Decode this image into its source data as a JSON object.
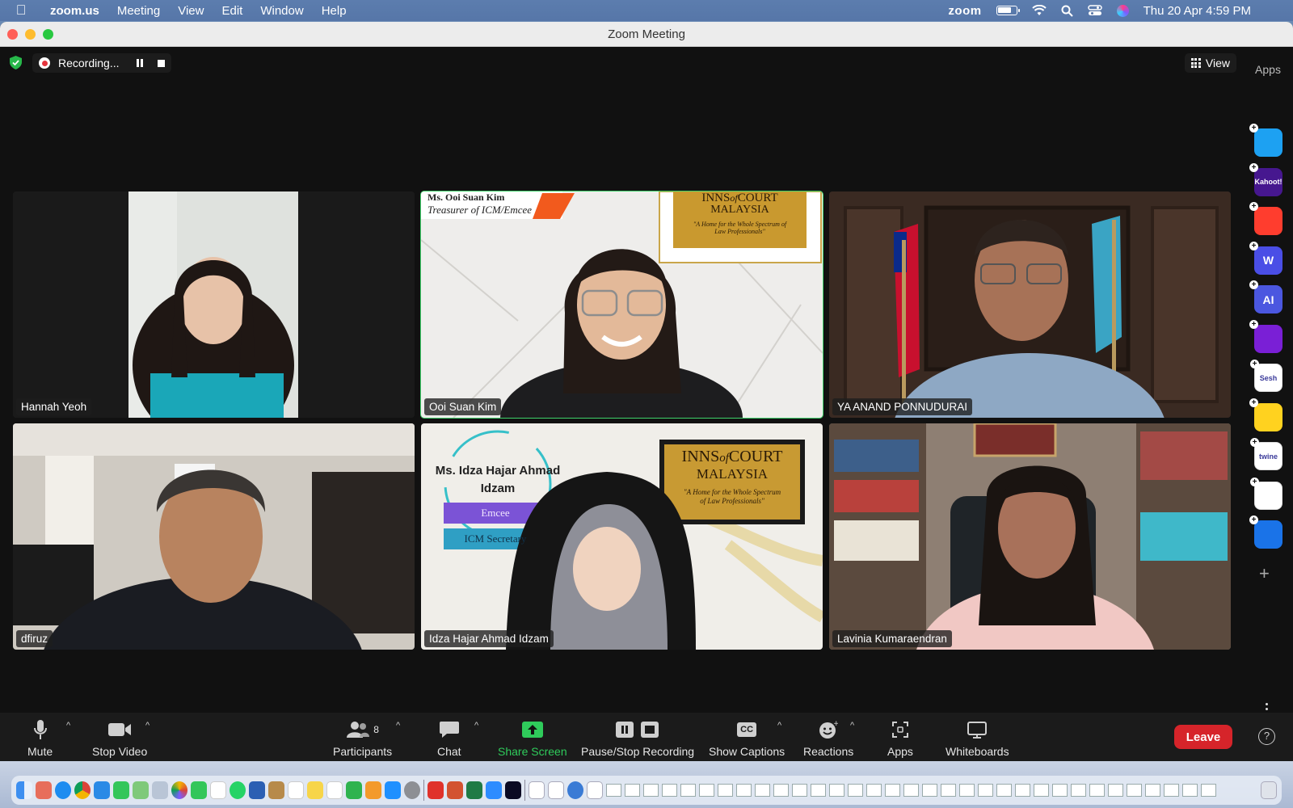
{
  "menubar": {
    "app": "zoom.us",
    "menus": [
      "Meeting",
      "View",
      "Edit",
      "Window",
      "Help"
    ],
    "status_app": "zoom",
    "datetime": "Thu 20 Apr  4:59 PM"
  },
  "window": {
    "title": "Zoom Meeting"
  },
  "recording": {
    "label": "Recording..."
  },
  "view_button": {
    "label": "View"
  },
  "participants": [
    {
      "name": "Hannah Yeoh",
      "active": false
    },
    {
      "name": "Ooi Suan Kim",
      "active": true
    },
    {
      "name": "YA ANAND PONNUDURAI",
      "active": false
    },
    {
      "name": "dfiruz",
      "active": false
    },
    {
      "name": "Idza Hajar Ahmad Idzam",
      "active": false
    },
    {
      "name": "Lavinia Kumaraendran",
      "active": false
    }
  ],
  "backgrounds": {
    "ooi_banner_name": "Ms. Ooi Suan Kim",
    "ooi_banner_role": "Treasurer of ICM/Emcee",
    "inns_title_1": "INNS",
    "inns_title_of": "of",
    "inns_title_2": "COURT",
    "inns_sub": "MALAYSIA",
    "inns_tagline": "\"A Home for the Whole Spectrum of Law Professionals\"",
    "idza_name_1": "Ms. Idza Hajar Ahmad",
    "idza_name_2": "Idzam",
    "idza_role_1": "Emcee",
    "idza_role_2": "ICM Secretary"
  },
  "apps_panel": {
    "title": "Apps",
    "apps": [
      {
        "name": "play-app-icon",
        "label": "",
        "color": "#1da1f2"
      },
      {
        "name": "kahoot-icon",
        "label": "Kahoot!",
        "color": "#46178f"
      },
      {
        "name": "orange-app-icon",
        "label": "",
        "color": "#ff3d2e"
      },
      {
        "name": "wordwall-icon",
        "label": "W",
        "color": "#4a4ee6"
      },
      {
        "name": "ai-app-icon",
        "label": "AI",
        "color": "#4b57e0"
      },
      {
        "name": "video-app-icon",
        "label": "",
        "color": "#7a1fd6"
      },
      {
        "name": "sesh-icon",
        "label": "Sesh",
        "color": "#ffffff"
      },
      {
        "name": "emoji-app-icon",
        "label": "",
        "color": "#ffd21f"
      },
      {
        "name": "twine-icon",
        "label": "twine",
        "color": "#ffffff"
      },
      {
        "name": "blocks-app-icon",
        "label": "",
        "color": "#ffffff"
      },
      {
        "name": "sync-app-icon",
        "label": "",
        "color": "#1a73e8"
      }
    ]
  },
  "toolbar": {
    "mute": "Mute",
    "stop_video": "Stop Video",
    "participants": "Participants",
    "participants_count": "8",
    "chat": "Chat",
    "share_screen": "Share Screen",
    "pause_stop_recording": "Pause/Stop Recording",
    "show_captions": "Show Captions",
    "captions_icon": "CC",
    "reactions": "Reactions",
    "apps": "Apps",
    "whiteboards": "Whiteboards",
    "leave": "Leave"
  },
  "colors": {
    "active_speaker": "#3fd26b",
    "share_green": "#2fcb5b",
    "leave_red": "#d6242a"
  }
}
